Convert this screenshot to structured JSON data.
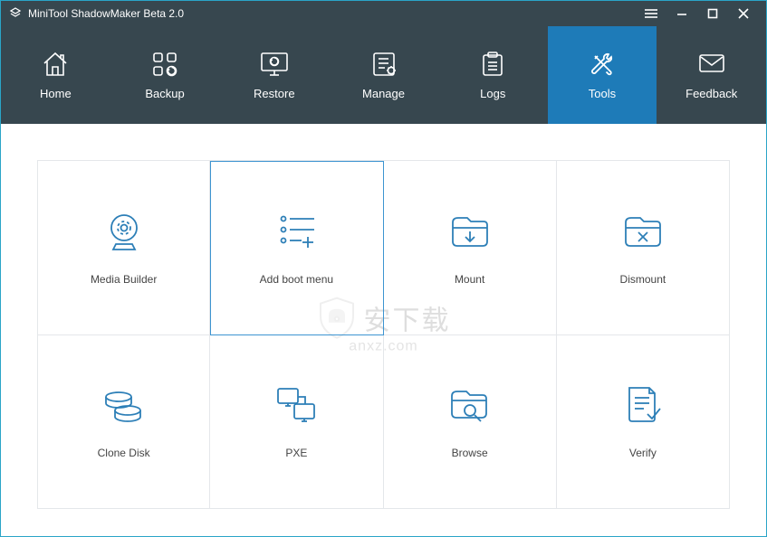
{
  "titlebar": {
    "title": "MiniTool ShadowMaker Beta 2.0"
  },
  "nav": {
    "items": [
      {
        "label": "Home"
      },
      {
        "label": "Backup"
      },
      {
        "label": "Restore"
      },
      {
        "label": "Manage"
      },
      {
        "label": "Logs"
      },
      {
        "label": "Tools"
      },
      {
        "label": "Feedback"
      }
    ],
    "active_index": 5
  },
  "tools": {
    "tiles": [
      {
        "label": "Media Builder"
      },
      {
        "label": "Add boot menu"
      },
      {
        "label": "Mount"
      },
      {
        "label": "Dismount"
      },
      {
        "label": "Clone Disk"
      },
      {
        "label": "PXE"
      },
      {
        "label": "Browse"
      },
      {
        "label": "Verify"
      }
    ],
    "selected_index": 1
  },
  "watermark": {
    "text": "安下载",
    "sub": "anxz.com"
  },
  "colors": {
    "titlebar": "#37474f",
    "accent": "#1e7bb8",
    "icon": "#2d7fb7",
    "border": "#e4e7ea"
  }
}
